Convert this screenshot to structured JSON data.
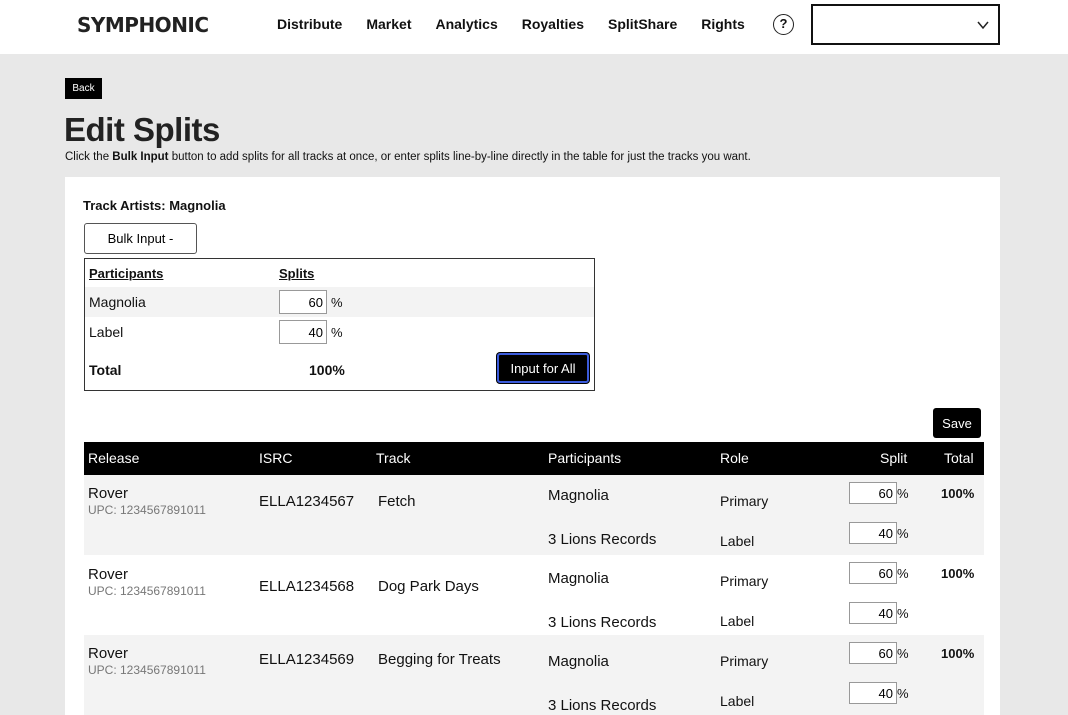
{
  "brand": "SYMPHONIC",
  "nav": [
    "Distribute",
    "Market",
    "Analytics",
    "Royalties",
    "SplitShare",
    "Rights"
  ],
  "help_glyph": "?",
  "back_label": "Back",
  "page_title": "Edit Splits",
  "instructions": {
    "pre": "Click the ",
    "bold": "Bulk Input",
    "post": " button to add splits for all tracks at once, or enter splits line-by-line directly in the table for just the tracks you want."
  },
  "track_artists": "Track Artists: Magnolia",
  "bulk_button": "Bulk Input -",
  "bulk": {
    "participants_header": "Participants",
    "splits_header": "Splits",
    "rows": [
      {
        "name": "Magnolia",
        "split": "60"
      },
      {
        "name": "Label",
        "split": "40"
      }
    ],
    "total_label": "Total",
    "total_value": "100%",
    "input_all_label": "Input for All"
  },
  "pct_symbol": "%",
  "save_label": "Save",
  "table": {
    "headers": [
      "Release",
      "ISRC",
      "Track",
      "Participants",
      "Role",
      "Split",
      "Total"
    ],
    "rows": [
      {
        "release": "Rover",
        "upc": "UPC: 1234567891011",
        "isrc": "ELLA1234567",
        "track": "Fetch",
        "total": "100%",
        "participants": [
          {
            "name": "Magnolia",
            "role": "Primary",
            "split": "60"
          },
          {
            "name": "3 Lions Records",
            "role": "Label",
            "split": "40"
          }
        ]
      },
      {
        "release": "Rover",
        "upc": "UPC: 1234567891011",
        "isrc": "ELLA1234568",
        "track": "Dog Park Days",
        "total": "100%",
        "participants": [
          {
            "name": "Magnolia",
            "role": "Primary",
            "split": "60"
          },
          {
            "name": "3 Lions Records",
            "role": "Label",
            "split": "40"
          }
        ]
      },
      {
        "release": "Rover",
        "upc": "UPC: 1234567891011",
        "isrc": "ELLA1234569",
        "track": "Begging for Treats",
        "total": "100%",
        "participants": [
          {
            "name": "Magnolia",
            "role": "Primary",
            "split": "60"
          },
          {
            "name": "3 Lions Records",
            "role": "Label",
            "split": "40"
          }
        ]
      }
    ]
  }
}
